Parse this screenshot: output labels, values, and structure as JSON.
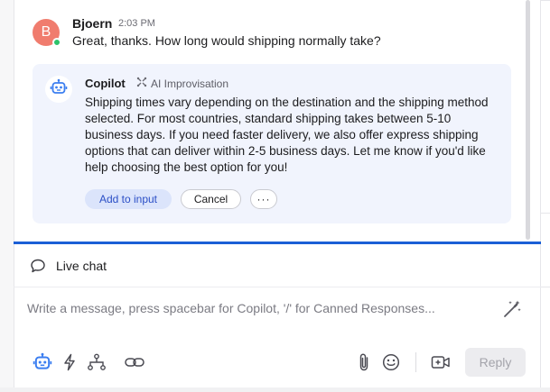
{
  "message": {
    "avatar_initial": "B",
    "author": "Bjoern",
    "time": "2:03 PM",
    "text": "Great, thanks. How long would shipping normally take?"
  },
  "copilot": {
    "name": "Copilot",
    "badge": "AI Improvisation",
    "response": "Shipping times vary depending on the destination and the shipping method selected. For most countries, standard shipping takes between 5-10 business days. If you need faster delivery, we also offer express shipping options that can deliver within 2-5 business days. Let me know if you'd like help choosing the best option for you!",
    "add_label": "Add to input",
    "cancel_label": "Cancel",
    "more_label": "···"
  },
  "composer": {
    "tab_label": "Live chat",
    "placeholder": "Write a message, press spacebar for Copilot, '/' for Canned Responses...",
    "value": "",
    "reply_label": "Reply"
  },
  "icons": {
    "copilot": "robot-icon",
    "badge": "sparkle-grid-icon",
    "chat": "chat-bubble-icon",
    "magic": "magic-wand-icon",
    "toolbar_left": [
      "robot-icon",
      "lightning-icon",
      "workflow-icon",
      "link-icon"
    ],
    "toolbar_right": [
      "paperclip-icon",
      "emoji-icon",
      "video-icon"
    ]
  },
  "colors": {
    "accent": "#1b5fd6",
    "avatar": "#f07c6e",
    "presence": "#2ec26b",
    "copilot_card": "#f1f4fd",
    "copilot_icon": "#3b7ef0"
  }
}
